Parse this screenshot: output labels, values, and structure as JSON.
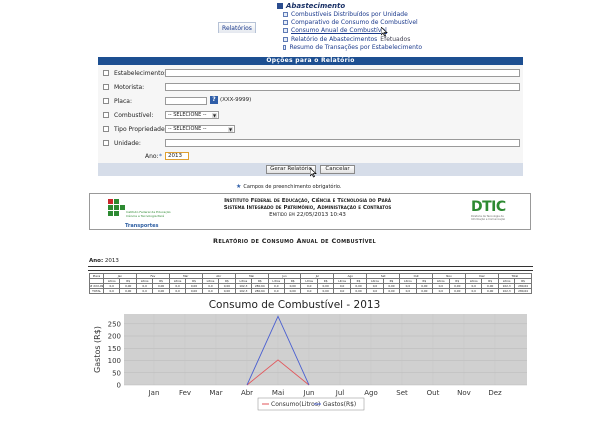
{
  "menu": {
    "heading": "Abastecimento",
    "items": [
      {
        "label": "Combustíveis Distribuídos por Unidade",
        "extra": ""
      },
      {
        "label": "Comparativo de Consumo de Combustível",
        "extra": ""
      },
      {
        "label": "Consumo Anual de Combustível",
        "extra": ""
      },
      {
        "label": "Relatório de Abastecimentos",
        "extra": "Efetuados"
      },
      {
        "label": "Resumo de Transações por Estabelecimento",
        "extra": ""
      }
    ]
  },
  "tab": {
    "label": "Relatórios"
  },
  "options": {
    "title": "Opções para o Relatório",
    "estabelecimento": {
      "label": "Estabelecimento:",
      "value": ""
    },
    "motorista": {
      "label": "Motorista:",
      "value": ""
    },
    "placa": {
      "label": "Placa:",
      "value": "",
      "hint": "(XXX-9999)"
    },
    "combustivel": {
      "label": "Combustível:",
      "selected": "-- SELECIONE --"
    },
    "tipo": {
      "label": "Tipo Propriedade:",
      "selected": "-- SELECIONE --"
    },
    "unidade": {
      "label": "Unidade:",
      "value": ""
    },
    "ano": {
      "label": "Ano:",
      "required_mark": "*",
      "value": "2013"
    }
  },
  "buttons": {
    "generate": "Gerar Relatório",
    "cancel": "Cancelar"
  },
  "required_note": "Campos de preenchimento obrigatório.",
  "header": {
    "logo_text": "Instituto Federal de Educação Ciência e Tecnologia Pará",
    "logo_sub": "Transportes",
    "institute": "Instituto Federal de Educação, Ciência e Tecnologia do Pará",
    "system": "Sistema Integrado de Patrimônio, Administração e Contratos",
    "emitted": "Emitido em 22/05/2013 10:43",
    "dtic": "DTIC",
    "dtic_sub": "Diretoria de Tecnologia da Informação e Comunicação"
  },
  "report": {
    "title": "Relatório de Consumo Anual de Combustível",
    "year_label": "Ano:",
    "year_value": "2013"
  },
  "table": {
    "months": [
      "Jan",
      "Fev",
      "Mar",
      "Abr",
      "Mai",
      "Jun",
      "Jul",
      "Ago",
      "Set",
      "Out",
      "Nov",
      "Dez",
      "Total"
    ],
    "sub": [
      "Litros",
      "R$"
    ],
    "first_col": "Placa",
    "rows": [
      {
        "label": "# XXX-9999",
        "cells": [
          "0,0",
          "0,00",
          "0,0",
          "0,00",
          "0,0",
          "0,00",
          "0,0",
          "0,00",
          "102,3",
          "280,64",
          "0,0",
          "0,00",
          "0,0",
          "0,00",
          "0,0",
          "0,00",
          "0,0",
          "0,00",
          "0,0",
          "0,00",
          "0,0",
          "0,00",
          "0,0",
          "0,00",
          "102,3",
          "280,64"
        ]
      },
      {
        "label": "TOTAL",
        "cells": [
          "0,0",
          "0,00",
          "0,0",
          "0,00",
          "0,0",
          "0,00",
          "0,0",
          "0,00",
          "102,3",
          "280,64",
          "0,0",
          "0,00",
          "0,0",
          "0,00",
          "0,0",
          "0,00",
          "0,0",
          "0,00",
          "0,0",
          "0,00",
          "0,0",
          "0,00",
          "0,0",
          "0,00",
          "102,3",
          "280,64"
        ]
      }
    ]
  },
  "chart_data": {
    "type": "line",
    "title": "Consumo de Combustível - 2013",
    "ylabel": "Gastos (R$)",
    "xlabel": "",
    "categories": [
      "Jan",
      "Fev",
      "Mar",
      "Abr",
      "Mai",
      "Jun",
      "Jul",
      "Ago",
      "Set",
      "Out",
      "Nov",
      "Dez"
    ],
    "x_start": "Abr",
    "series": [
      {
        "name": "Consumo(Litros)",
        "color": "#e2555a",
        "values": [
          null,
          null,
          null,
          0,
          102.3,
          0,
          null,
          null,
          null,
          null,
          null,
          null
        ]
      },
      {
        "name": "Gastos(R$)",
        "color": "#4a5fd0",
        "values": [
          null,
          null,
          null,
          0,
          280.64,
          0,
          null,
          null,
          null,
          null,
          null,
          null
        ]
      }
    ],
    "yticks": [
      0,
      50,
      100,
      150,
      200,
      250
    ],
    "ylim": [
      0,
      290
    ],
    "grid": true,
    "legend": "bottom"
  }
}
